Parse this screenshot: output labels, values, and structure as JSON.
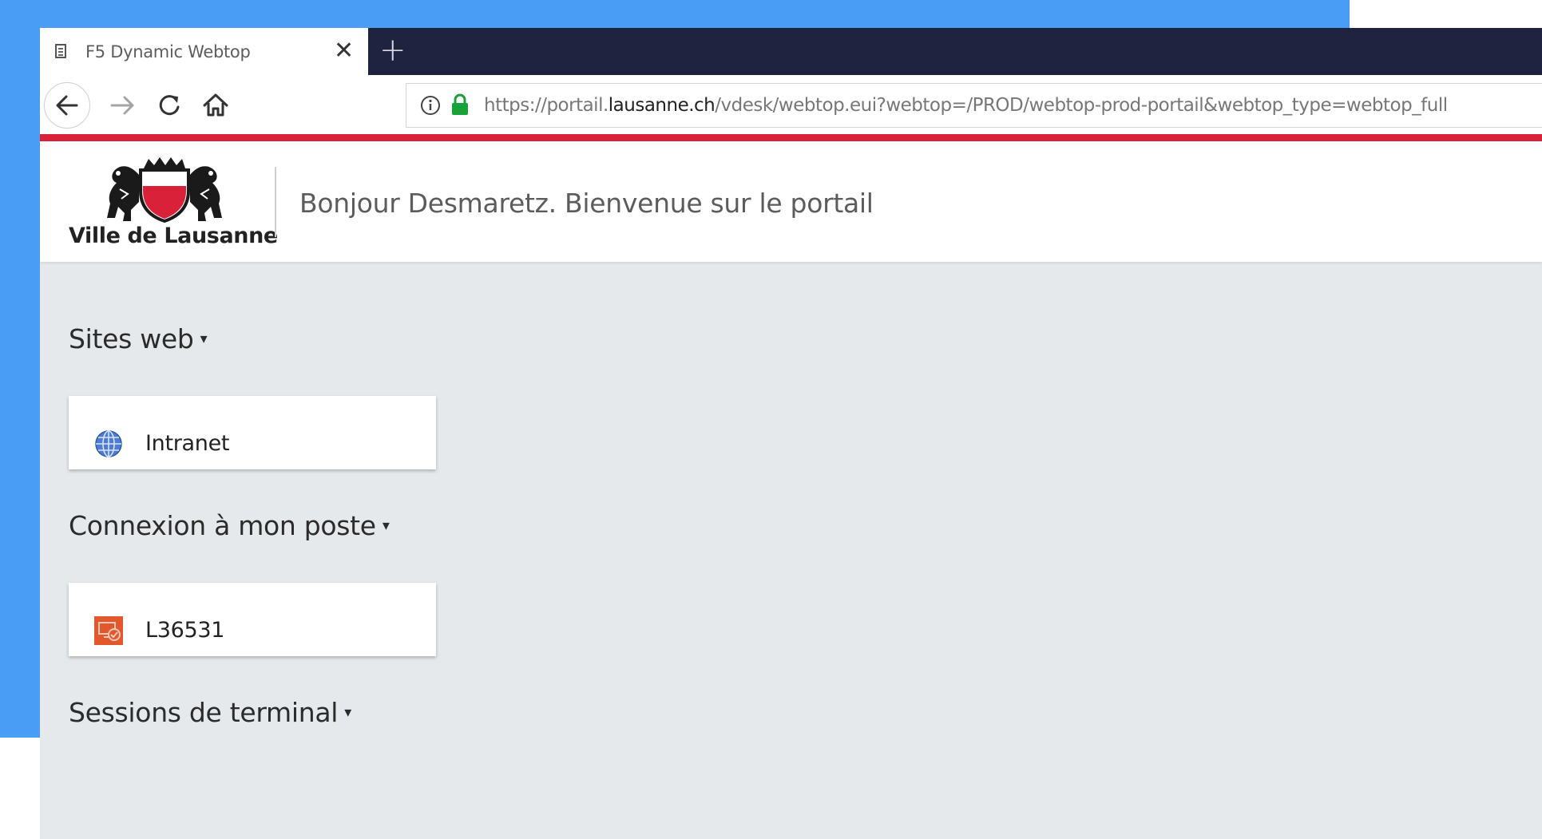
{
  "browser": {
    "tab": {
      "title": "F5 Dynamic Webtop",
      "close_glyph": "✕",
      "page_icon": "page-icon"
    },
    "new_tab_glyph": "+",
    "nav": {
      "back_icon": "back-arrow-icon",
      "forward_icon": "forward-arrow-icon",
      "reload_icon": "reload-icon",
      "home_icon": "home-icon"
    },
    "url": {
      "prefix": "https://portail.",
      "domain": "lausanne.ch",
      "path": "/vdesk/webtop.eui?webtop=/PROD/webtop-prod-portail&webtop_type=webtop_full",
      "info_icon": "info-icon",
      "lock_icon": "lock-icon"
    },
    "colors": {
      "tabstrip": "#202340",
      "accent_red": "#d9223a",
      "page_bg": "#e6e9ec",
      "outer_blue": "#4a9df4"
    }
  },
  "header": {
    "logo_text": "Ville de Lausanne",
    "welcome": "Bonjour Desmaretz. Bienvenue sur le portail"
  },
  "sections": [
    {
      "title": "Sites web",
      "caret": "▾",
      "items": [
        {
          "label": "Intranet",
          "icon": "globe-icon"
        }
      ]
    },
    {
      "title": "Connexion à mon poste",
      "caret": "▾",
      "items": [
        {
          "label": "L36531",
          "icon": "remote-desktop-icon"
        }
      ]
    },
    {
      "title": "Sessions de terminal",
      "caret": "▾",
      "items": []
    }
  ]
}
